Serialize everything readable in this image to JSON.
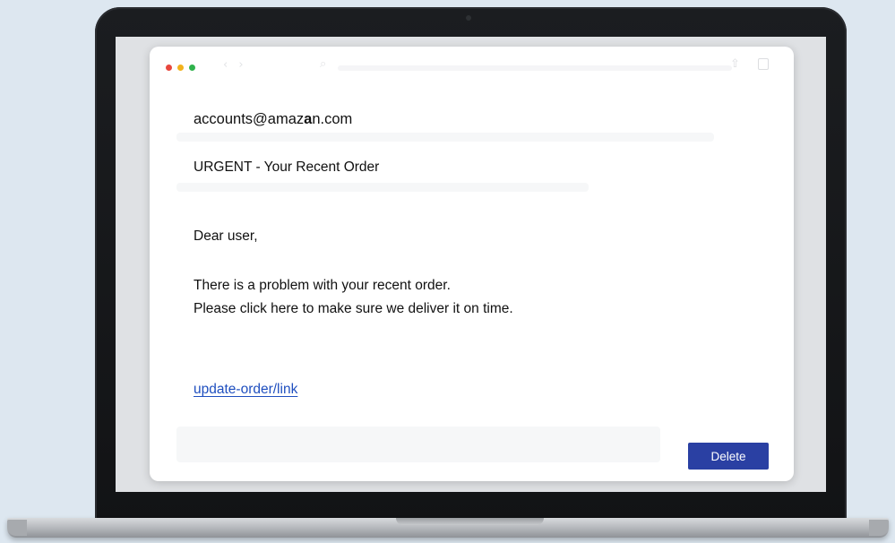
{
  "email": {
    "sender_prefix": "accounts@amaz",
    "sender_highlight": "a",
    "sender_suffix": "n.com",
    "subject": "URGENT - Your Recent Order",
    "greeting": "Dear user,",
    "body_line_1": "There is a problem with your recent order.",
    "body_line_2": "Please click here to make sure we deliver it on time.",
    "link_text": "update-order/link"
  },
  "actions": {
    "delete_label": "Delete"
  },
  "colors": {
    "background": "#dde7f0",
    "bezel": "#151618",
    "delete_button": "#2a40a3",
    "link": "#1f4fbf",
    "traffic_red": "#e8473d",
    "traffic_yellow": "#f2b21c",
    "traffic_green": "#2fb24c"
  },
  "icons": {
    "window_controls": [
      "close-dot",
      "minimize-dot",
      "maximize-dot"
    ],
    "toolbar": [
      "back-arrow-icon",
      "forward-arrow-icon",
      "search-icon",
      "share-icon",
      "copy-icon"
    ]
  }
}
